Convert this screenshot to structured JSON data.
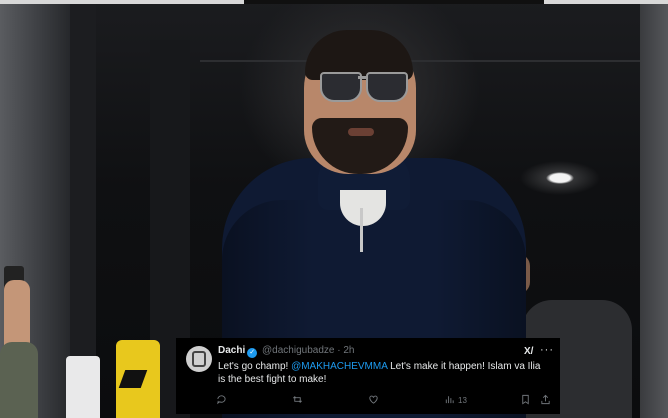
{
  "tweet": {
    "display_name": "Dachi",
    "handle": "@dachigubadze",
    "separator": "·",
    "time": "2h",
    "text_before": "Let's go champ! ",
    "mention": "@MAKHACHEVMMA",
    "text_after": "  Let's make it happen! Islam va Ilia is the best fight to make!",
    "views": "13",
    "grok_label": "X/",
    "more_label": "···"
  },
  "icons": {
    "avatar": "avatar",
    "verified": "verified-check-icon",
    "reply": "reply-icon",
    "retweet": "retweet-icon",
    "like": "heart-icon",
    "views": "bar-chart-icon",
    "bookmark": "bookmark-icon",
    "share": "share-icon"
  },
  "colors": {
    "accent": "#1d9bf0",
    "tweet_bg": "#000000",
    "muted": "#71767b"
  }
}
